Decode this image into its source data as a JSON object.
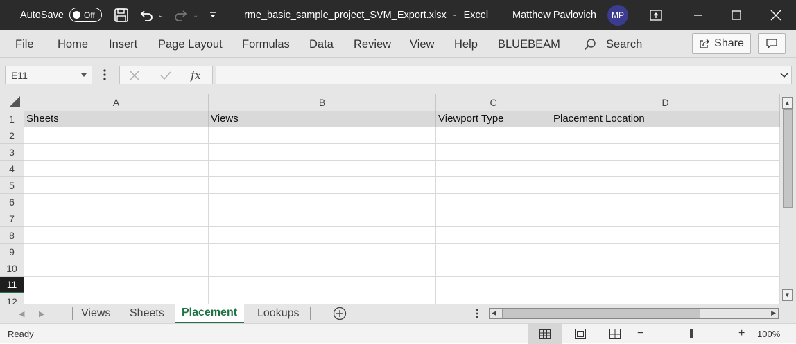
{
  "titlebar": {
    "autosave_label": "AutoSave",
    "autosave_state": "Off",
    "filename": "rme_basic_sample_project_SVM_Export.xlsx",
    "separator": "-",
    "app": "Excel",
    "user_name": "Matthew Pavlovich",
    "user_initials": "MP"
  },
  "ribbon": {
    "tabs": [
      "File",
      "Home",
      "Insert",
      "Page Layout",
      "Formulas",
      "Data",
      "Review",
      "View",
      "Help",
      "BLUEBEAM"
    ],
    "search_label": "Search",
    "share_label": "Share"
  },
  "formula_bar": {
    "name_box": "E11",
    "fx_label": "fx",
    "formula_value": ""
  },
  "sheet": {
    "columns": [
      "A",
      "B",
      "C",
      "D"
    ],
    "rows": [
      "1",
      "2",
      "3",
      "4",
      "5",
      "6",
      "7",
      "8",
      "9",
      "10",
      "11",
      "12"
    ],
    "selected_row": "11",
    "header_row": [
      "Sheets",
      "Views",
      "Viewport Type",
      "Placement Location"
    ]
  },
  "sheet_tabs": {
    "tabs": [
      "Views",
      "Sheets",
      "Placement",
      "Lookups"
    ],
    "active": "Placement"
  },
  "status_bar": {
    "status": "Ready",
    "zoom": "100%",
    "zoom_minus": "−",
    "zoom_plus": "+"
  },
  "colors": {
    "accent": "#217346",
    "titlebar": "#2b2b2b",
    "avatar": "#3b3b8f"
  }
}
